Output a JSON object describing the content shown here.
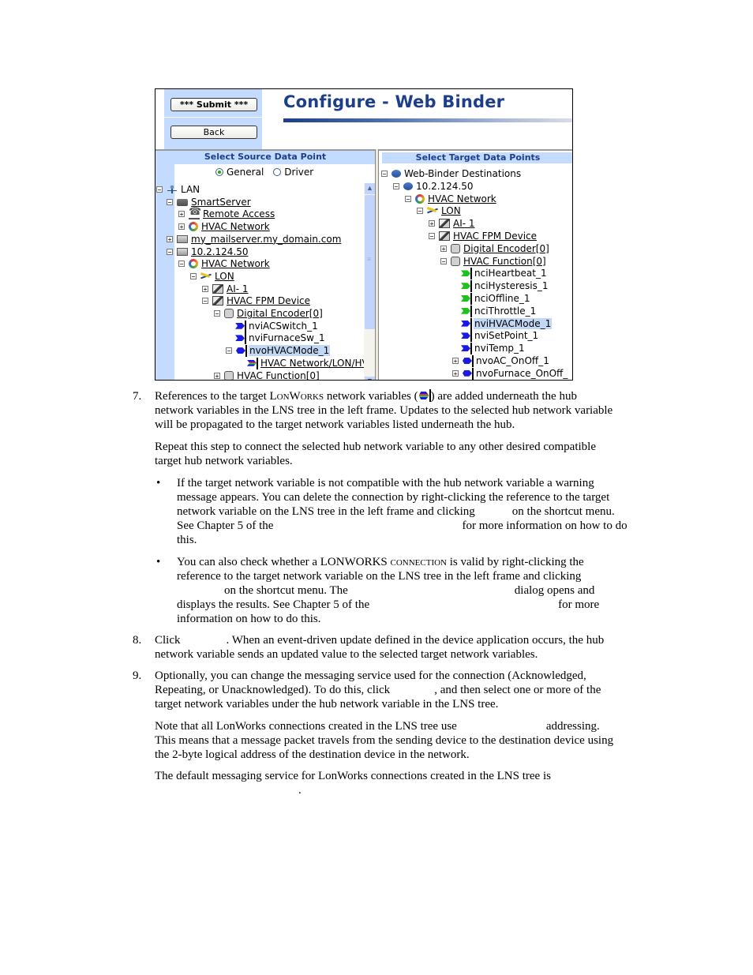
{
  "screenshot": {
    "buttons": {
      "submit": "*** Submit ***",
      "back": "Back"
    },
    "title": "Configure - Web Binder",
    "source_pane": {
      "caption": "Select Source Data Point",
      "radio_options": [
        {
          "label": "General",
          "selected": true
        },
        {
          "label": "Driver",
          "selected": false
        }
      ],
      "tree": [
        {
          "label": "LAN",
          "icon": "lan-icon",
          "expander": "minus",
          "link": false
        },
        {
          "label": "SmartServer",
          "icon": "server-icon",
          "expander": "minus",
          "link": true
        },
        {
          "label": "Remote Access",
          "icon": "phone-icon",
          "expander": "plus",
          "link": true
        },
        {
          "label": "HVAC Network",
          "icon": "hvac-network-icon",
          "expander": "plus",
          "link": true
        },
        {
          "label": "my_mailserver.my_domain.com",
          "icon": "computer-icon",
          "expander": "plus",
          "link": true
        },
        {
          "label": "10.2.124.50",
          "icon": "computer-icon",
          "expander": "minus",
          "link": true
        },
        {
          "label": "HVAC Network",
          "icon": "hvac-network-icon",
          "expander": "minus",
          "link": true
        },
        {
          "label": "LON",
          "icon": "lon-channel-icon",
          "expander": "minus",
          "link": true
        },
        {
          "label": "AI- 1",
          "icon": "device-icon",
          "expander": "plus",
          "link": true
        },
        {
          "label": "HVAC FPM Device",
          "icon": "device-icon",
          "expander": "minus",
          "link": true
        },
        {
          "label": "Digital Encoder[0]",
          "icon": "functional-block-icon",
          "expander": "minus",
          "link": true
        },
        {
          "label": "nviACSwitch_1",
          "icon": "input-nv-icon",
          "expander": "",
          "link": false
        },
        {
          "label": "nviFurnaceSw_1",
          "icon": "input-nv-icon",
          "expander": "",
          "link": false
        },
        {
          "label": "nvoHVACMode_1",
          "icon": "output-nv-icon",
          "expander": "minus",
          "link": false,
          "selected": true
        },
        {
          "label": "HVAC Network/LON/HV",
          "icon": "nv-reference-icon",
          "expander": "",
          "link": true
        },
        {
          "label": "HVAC Function[0]",
          "icon": "functional-block-icon",
          "expander": "plus",
          "link": true
        }
      ]
    },
    "target_pane": {
      "caption": "Select Target Data Points",
      "tree": [
        {
          "label": "Web-Binder Destinations",
          "icon": "destinations-icon",
          "expander": "minus",
          "link": false
        },
        {
          "label": "10.2.124.50",
          "icon": "destinations-icon",
          "expander": "minus",
          "link": false
        },
        {
          "label": "HVAC Network",
          "icon": "hvac-network-icon",
          "expander": "minus",
          "link": true
        },
        {
          "label": "LON",
          "icon": "lon-channel-icon",
          "expander": "minus",
          "link": true
        },
        {
          "label": "AI- 1",
          "icon": "device-icon",
          "expander": "plus",
          "link": true
        },
        {
          "label": "HVAC FPM Device",
          "icon": "device-icon",
          "expander": "minus",
          "link": true
        },
        {
          "label": "Digital Encoder[0]",
          "icon": "functional-block-icon",
          "expander": "plus",
          "link": true
        },
        {
          "label": "HVAC Function[0]",
          "icon": "functional-block-icon",
          "expander": "minus",
          "link": true
        },
        {
          "label": "nciHeartbeat_1",
          "icon": "config-nv-icon",
          "expander": "",
          "link": false
        },
        {
          "label": "nciHysteresis_1",
          "icon": "config-nv-icon",
          "expander": "",
          "link": false
        },
        {
          "label": "nciOffline_1",
          "icon": "config-nv-icon",
          "expander": "",
          "link": false
        },
        {
          "label": "nciThrottle_1",
          "icon": "config-nv-icon",
          "expander": "",
          "link": false
        },
        {
          "label": "nviHVACMode_1",
          "icon": "input-nv-icon",
          "expander": "",
          "link": false,
          "selected": true
        },
        {
          "label": "nviSetPoint_1",
          "icon": "input-nv-icon",
          "expander": "",
          "link": false
        },
        {
          "label": "nviTemp_1",
          "icon": "input-nv-icon",
          "expander": "",
          "link": false
        },
        {
          "label": "nvoAC_OnOff_1",
          "icon": "output-nv-icon",
          "expander": "plus",
          "link": false
        },
        {
          "label": "nvoFurnace_OnOff_",
          "icon": "output-nv-icon",
          "expander": "plus",
          "link": false
        }
      ]
    }
  },
  "document": {
    "step7": {
      "number": "7.",
      "line1_a": "References to the target ",
      "lonworks": "LonWorks",
      "line1_b": " network variables (",
      "line1_c": ") are added underneath the hub",
      "line2": "network variables in the LNS tree in the left frame.  Updates to the selected hub network variable",
      "line3": "will be propagated to the target network variables listed underneath the hub.",
      "repeat1": "Repeat this step to connect the selected hub network variable to any other desired compatible",
      "repeat2": "target hub network variables."
    },
    "bullet1": {
      "mark": "•",
      "l1": "If the target network variable is not compatible with the hub network variable a warning",
      "l2": "message appears.  You can delete the connection by right-clicking the reference to the target",
      "l3a": "network variable on the LNS tree in the left frame and clicking",
      "l3b": "on the shortcut menu.",
      "l4a": "See Chapter 5 of the",
      "l4b": "for more information on how to do",
      "l5": "this."
    },
    "bullet2": {
      "mark": "•",
      "l1a": "You can also check whether a LONWORKS ",
      "l1b": "connection",
      "l1c": " is valid by right-clicking the",
      "l2": "reference to the target network variable on the LNS tree in the left frame and clicking",
      "l3a": "on the shortcut menu. The",
      "l3b": "dialog opens and",
      "l4a": "displays the results. See Chapter 5 of the",
      "l4b": "for more",
      "l5": "information on how to do this."
    },
    "step8": {
      "number": "8.",
      "l1a": "Click",
      "l1b": ".  When an event-driven update defined in the device application occurs, the hub",
      "l2": "network variable sends an updated value to the selected target network variables."
    },
    "step9": {
      "number": "9.",
      "l1": "Optionally, you can change the messaging service used for the connection (Acknowledged,",
      "l2a": "Repeating, or Unacknowledged).  To do this, click",
      "l2b": ", and then select one or more of the",
      "l3": "target network variables under the hub network variable in the LNS tree.",
      "note1a": "Note that all LonWorks connections created in the LNS tree use",
      "note1b": "addressing.",
      "note2": "This means that a message packet travels from the sending device to the destination device using",
      "note3": "the 2-byte logical address of the destination device in the network.",
      "default1": "The default messaging service for LonWorks connections created in the LNS tree is",
      "default2": "."
    }
  }
}
